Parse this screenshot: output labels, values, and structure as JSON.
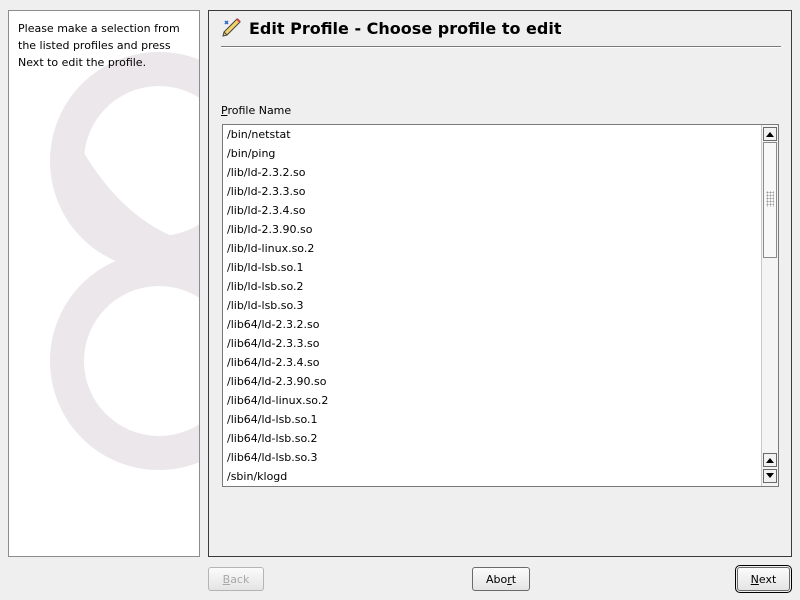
{
  "help": {
    "text": "Please make a selection from the listed profiles and press Next to edit the profile."
  },
  "header": {
    "title": "Edit Profile - Choose profile to edit",
    "icon": "edit-pencil-icon"
  },
  "profile_list": {
    "label_mnemonic": "P",
    "label_rest": "rofile Name",
    "items": [
      "/bin/netstat",
      "/bin/ping",
      "/lib/ld-2.3.2.so",
      "/lib/ld-2.3.3.so",
      "/lib/ld-2.3.4.so",
      "/lib/ld-2.3.90.so",
      "/lib/ld-linux.so.2",
      "/lib/ld-lsb.so.1",
      "/lib/ld-lsb.so.2",
      "/lib/ld-lsb.so.3",
      "/lib64/ld-2.3.2.so",
      "/lib64/ld-2.3.3.so",
      "/lib64/ld-2.3.4.so",
      "/lib64/ld-2.3.90.so",
      "/lib64/ld-linux.so.2",
      "/lib64/ld-lsb.so.1",
      "/lib64/ld-lsb.so.2",
      "/lib64/ld-lsb.so.3",
      "/sbin/klogd"
    ]
  },
  "buttons": {
    "back": {
      "mnemonic": "B",
      "rest": "ack",
      "enabled": false
    },
    "abort": {
      "pre": "Abo",
      "mnemonic": "r",
      "post": "t"
    },
    "next": {
      "mnemonic": "N",
      "rest": "ext"
    }
  },
  "colors": {
    "window_bg": "#efefef",
    "panel_border": "#3a3a3a",
    "watermark": "#e8e4e6"
  }
}
